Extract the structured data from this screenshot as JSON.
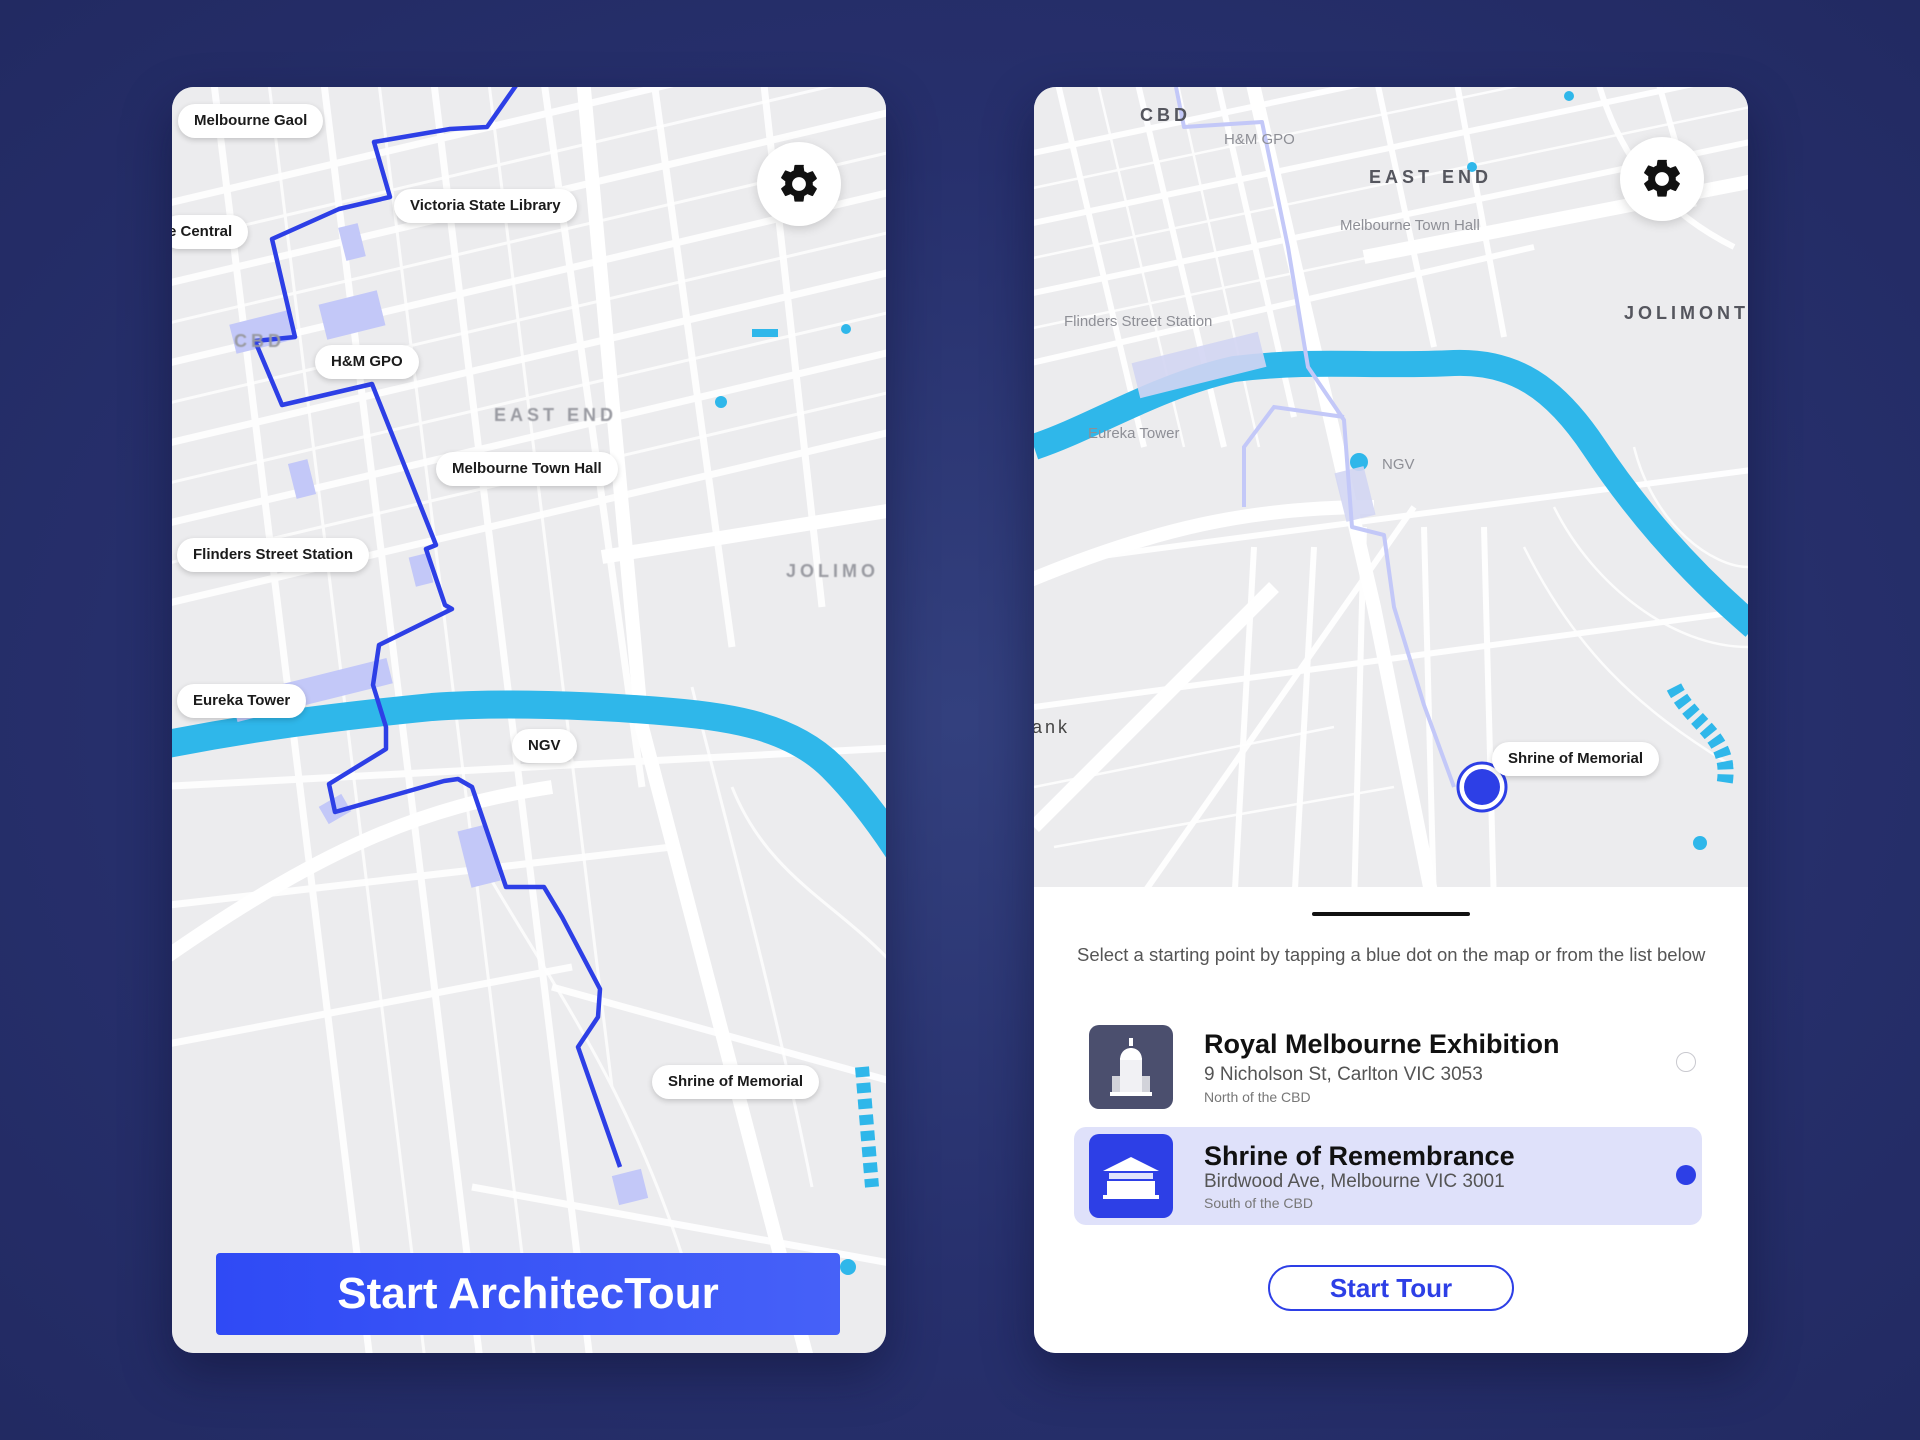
{
  "colors": {
    "background": "#27306d",
    "route": "#2d3fe6",
    "river": "#2fb7ea",
    "building_highlight": "#c3c8f8",
    "selected_row": "#dfe1fa",
    "cta": "#3550f7"
  },
  "left_screen": {
    "settings_icon": "gear-icon",
    "pins": [
      "Melbourne Gaol",
      "Victoria State Library",
      "e Central",
      "H&M GPO",
      "Melbourne Town Hall",
      "Flinders Street Station",
      "Eureka Tower",
      "NGV",
      "Shrine of Memorial"
    ],
    "districts": [
      "CBD",
      "EAST END",
      "JOLIMO"
    ],
    "cta_label": "Start ArchitecTour"
  },
  "right_screen": {
    "settings_icon": "gear-icon",
    "districts": [
      "CBD",
      "EAST END",
      "JOLIMONT"
    ],
    "map_labels": {
      "gpo": "H&M GPO",
      "town_hall": "Melbourne Town Hall",
      "flinders": "Flinders Street Station",
      "eureka": "Eureka Tower",
      "ngv": "NGV",
      "bank": "ank"
    },
    "selected_pin": "Shrine of Memorial",
    "instruction": "Select a starting point by tapping a blue dot on the map or from the list below",
    "options": [
      {
        "title": "Royal Melbourne Exhibition",
        "address": "9 Nicholson St, Carlton VIC 3053",
        "area": "North of the CBD",
        "icon": "exhibition-building-icon",
        "selected": false
      },
      {
        "title": "Shrine of Remembrance",
        "address": "Birdwood Ave, Melbourne VIC 3001",
        "area": "South of the CBD",
        "icon": "shrine-icon",
        "selected": true
      }
    ],
    "start_button": "Start Tour"
  }
}
